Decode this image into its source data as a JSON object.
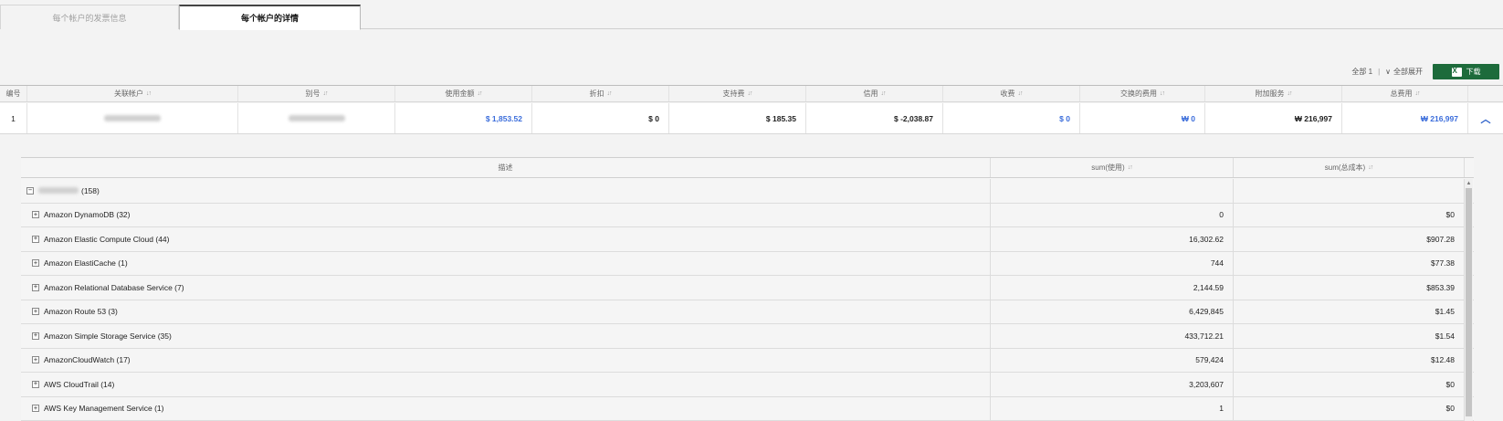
{
  "tabs": [
    {
      "label": "每个帐户的发票信息",
      "active": false
    },
    {
      "label": "每个帐户的详情",
      "active": true
    }
  ],
  "toolbar": {
    "total_label": "全部 1",
    "expand_label": "全部展开",
    "download_label": "下载"
  },
  "main_table": {
    "columns": [
      "编号",
      "关联帐户",
      "别号",
      "使用金额",
      "折扣",
      "支持费",
      "信用",
      "收费",
      "交换的费用",
      "附加服务",
      "总费用"
    ],
    "row": {
      "no": "1",
      "usage": "$ 1,853.52",
      "discount": "$ 0",
      "support": "$ 185.35",
      "credit": "$ -2,038.87",
      "charge": "$ 0",
      "exchanged": "₩ 0",
      "addon": "₩ 216,997",
      "total": "₩ 216,997"
    }
  },
  "detail_table": {
    "columns": [
      "描述",
      "sum(使用)",
      "sum(总成本)"
    ],
    "group": {
      "count": "(158)"
    },
    "rows": [
      {
        "desc": "Amazon DynamoDB (32)",
        "usage": "0",
        "cost": "$0"
      },
      {
        "desc": "Amazon Elastic Compute Cloud (44)",
        "usage": "16,302.62",
        "cost": "$907.28"
      },
      {
        "desc": "Amazon ElastiCache (1)",
        "usage": "744",
        "cost": "$77.38"
      },
      {
        "desc": "Amazon Relational Database Service (7)",
        "usage": "2,144.59",
        "cost": "$853.39"
      },
      {
        "desc": "Amazon Route 53 (3)",
        "usage": "6,429,845",
        "cost": "$1.45"
      },
      {
        "desc": "Amazon Simple Storage Service (35)",
        "usage": "433,712.21",
        "cost": "$1.54"
      },
      {
        "desc": "AmazonCloudWatch (17)",
        "usage": "579,424",
        "cost": "$12.48"
      },
      {
        "desc": "AWS CloudTrail (14)",
        "usage": "3,203,607",
        "cost": "$0"
      },
      {
        "desc": "AWS Key Management Service (1)",
        "usage": "1",
        "cost": "$0"
      }
    ]
  },
  "colors": {
    "accent_blue": "#3b6ddb",
    "download_green": "#1d6b3b"
  }
}
